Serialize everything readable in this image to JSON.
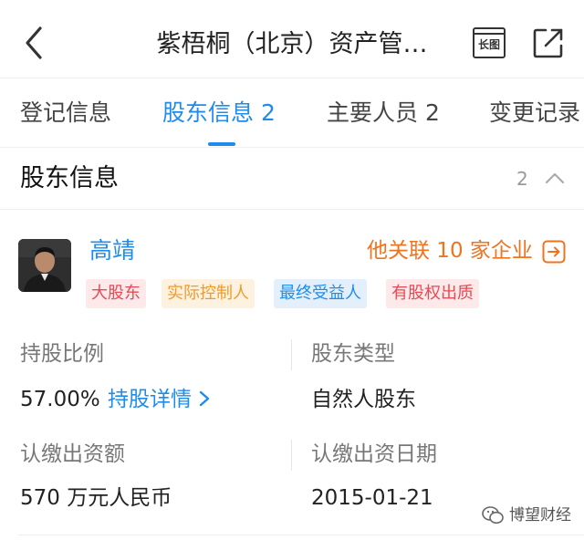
{
  "nav": {
    "title": "紫梧桐（北京）资产管…",
    "long_image_label": "长图"
  },
  "tabs": [
    {
      "label": "登记信息",
      "active": false
    },
    {
      "label": "股东信息 2",
      "active": true
    },
    {
      "label": "主要人员 2",
      "active": false
    },
    {
      "label": "变更记录",
      "active": false
    }
  ],
  "section": {
    "title": "股东信息",
    "count": "2"
  },
  "shareholder": {
    "name": "高靖",
    "related_link": "他关联 10 家企业",
    "tags": [
      "大股东",
      "实际控制人",
      "最终受益人",
      "有股权出质"
    ],
    "share_ratio_label": "持股比例",
    "share_ratio_value": "57.00%",
    "share_detail_link": "持股详情",
    "holder_type_label": "股东类型",
    "holder_type_value": "自然人股东",
    "subscribed_amount_label": "认缴出资额",
    "subscribed_amount_value": "570 万元人民币",
    "subscribed_date_label": "认缴出资日期",
    "subscribed_date_value": "2015-01-21"
  },
  "watermark": {
    "text": "博望财经"
  },
  "colors": {
    "accent_blue": "#1f8ceb",
    "accent_orange": "#f0731e",
    "tag_red": "#e44b55",
    "tag_orange": "#ef9b2c"
  }
}
